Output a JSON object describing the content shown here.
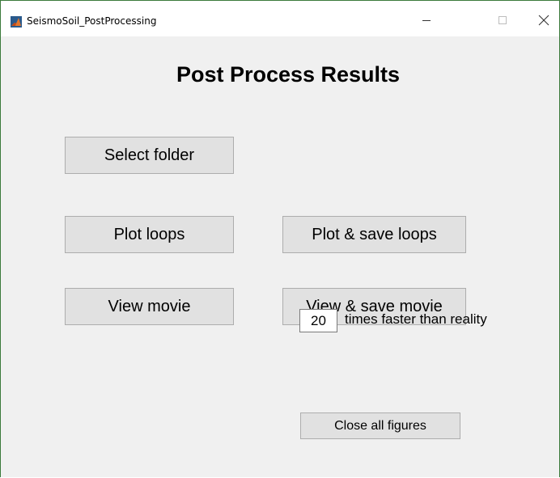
{
  "window": {
    "title": "SeismoSoil_PostProcessing",
    "app_icon": "matlab-icon",
    "controls": {
      "minimize_icon": "minimize-icon",
      "maximize_icon": "maximize-icon",
      "close_icon": "close-icon"
    }
  },
  "main": {
    "heading": "Post Process Results",
    "buttons": {
      "select_folder": "Select folder",
      "plot_loops": "Plot loops",
      "plot_save_loops": "Plot & save loops",
      "view_movie": "View movie",
      "view_save_movie": "View & save movie",
      "close_all_figures": "Close all figures"
    },
    "speed": {
      "value": "20",
      "label": "times faster than reality"
    }
  },
  "colors": {
    "background": "#f0f0f0",
    "button_face": "#e1e1e1",
    "button_border": "#adadad",
    "window_border": "#3b7a3b"
  }
}
